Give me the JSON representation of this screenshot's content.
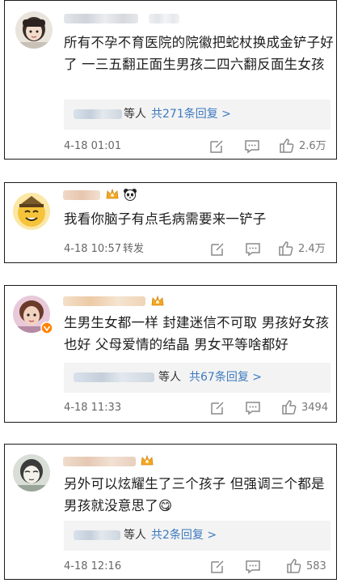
{
  "comments": [
    {
      "content": "所有不孕不育医院的院徽把蛇杖换成金铲子好了 一三五翻正面生男孩二四六翻反面生女孩",
      "reply": {
        "suffix": "等人",
        "link": "共271条回复 >"
      },
      "time": "4-18 01:01",
      "action": "",
      "likes": "2.6万"
    },
    {
      "content": "我看你脑子有点毛病需要来一铲子",
      "time": "4-18 10:57",
      "action": "转发",
      "likes": "2.4万"
    },
    {
      "content": "生男生女都一样 封建迷信不可取 男孩好女孩也好 父母爱情的结晶 男女平等啥都好",
      "reply": {
        "suffix": "等人",
        "link": "共67条回复 >"
      },
      "time": "4-18 11:33",
      "action": "",
      "likes": "3494"
    },
    {
      "content": "另外可以炫耀生了三个孩子 但强调三个都是男孩就没意思了😋",
      "reply": {
        "suffix": "等人",
        "link": "共2条回复 >"
      },
      "time": "4-18 12:16",
      "action": "",
      "likes": "583"
    }
  ],
  "icons": {
    "edit": "edit-icon",
    "comment": "comment-icon",
    "like": "thumbs-up-icon",
    "crown": "crown-badge-icon",
    "panda": "panda-badge-icon",
    "verified": "verified-badge-icon"
  },
  "colors": {
    "link": "#3d7abf",
    "verified": "#ff8200",
    "border": "#1a1a1a"
  }
}
